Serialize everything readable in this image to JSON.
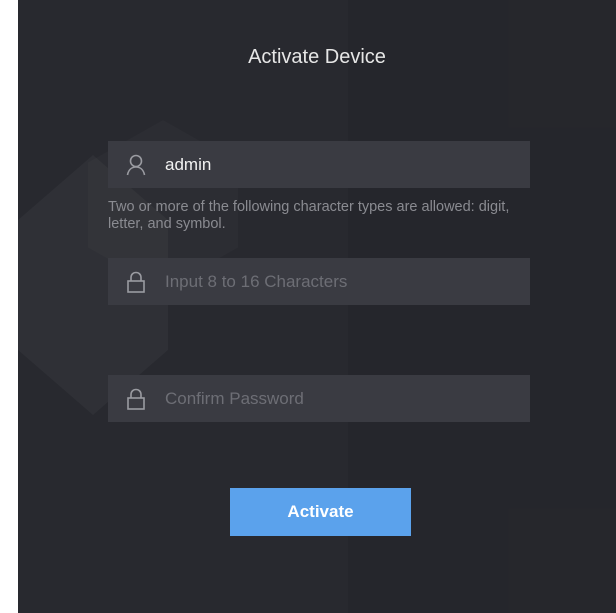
{
  "dialog": {
    "title": "Activate Device"
  },
  "username": {
    "value": "admin",
    "icon": "user-icon"
  },
  "password_hint": "Two or more of the following character types are allowed: digit, letter, and symbol.",
  "password": {
    "placeholder": "Input 8 to 16 Characters",
    "icon": "lock-icon"
  },
  "confirm_password": {
    "placeholder": "Confirm Password",
    "icon": "lock-icon"
  },
  "activate_button": {
    "label": "Activate"
  },
  "colors": {
    "background": "#28292f",
    "field": "#3a3b42",
    "accent": "#5ba2ec"
  }
}
